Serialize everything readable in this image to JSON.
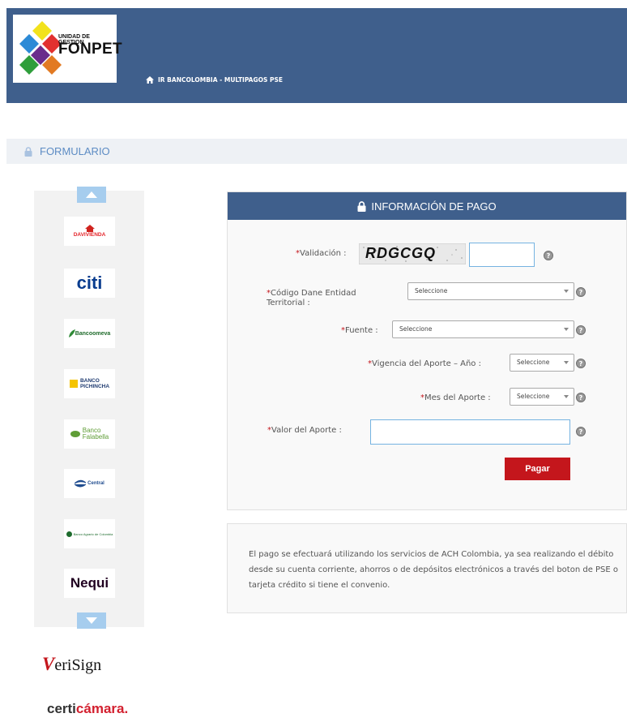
{
  "header": {
    "logo_small": "UNIDAD DE GESTION",
    "logo_big": "FONPET",
    "breadcrumb": "IR BANCOLOMBIA - MULTIPAGOS PSE",
    "colors": {
      "bar": "#3f5f8c"
    }
  },
  "section": {
    "title": "FORMULARIO"
  },
  "carousel": {
    "banks": [
      {
        "name": "DAVIVIENDA"
      },
      {
        "name": "citi"
      },
      {
        "name": "Bancoomeva"
      },
      {
        "name_line1": "BANCO",
        "name_line2": "PICHINCHA"
      },
      {
        "name_line1": "Banco",
        "name_line2": "Falabella"
      },
      {
        "name": "Central"
      },
      {
        "name": "Banco Agrario de Colombia"
      },
      {
        "name": "Nequi"
      }
    ]
  },
  "seals": {
    "verisign_v": "V",
    "verisign_rest": "eriSign",
    "certicamara_a": "certi",
    "certicamara_b": "cámara."
  },
  "form": {
    "header": "INFORMACIÓN DE PAGO",
    "captcha_text": "RDGCGQ",
    "help_symbol": "?",
    "fields": {
      "validacion": "Validación :",
      "codigo_line1": "Código Dane Entidad",
      "codigo_line2": "Territorial :",
      "fuente": "Fuente :",
      "vigencia": "Vigencia del Aporte – Año :",
      "mes": "Mes del Aporte :",
      "valor": "Valor del Aporte :"
    },
    "select_placeholder": "Seleccione",
    "pay_button": "Pagar",
    "colors": {
      "accent": "#c4161c",
      "input_border": "#75b3e1"
    }
  },
  "info": {
    "text": "El pago se efectuará utilizando los servicios de ACH Colombia, ya sea realizando el débito desde su cuenta corriente, ahorros o de depósitos electrónicos a través del boton de PSE o tarjeta crédito si tiene el convenio."
  }
}
